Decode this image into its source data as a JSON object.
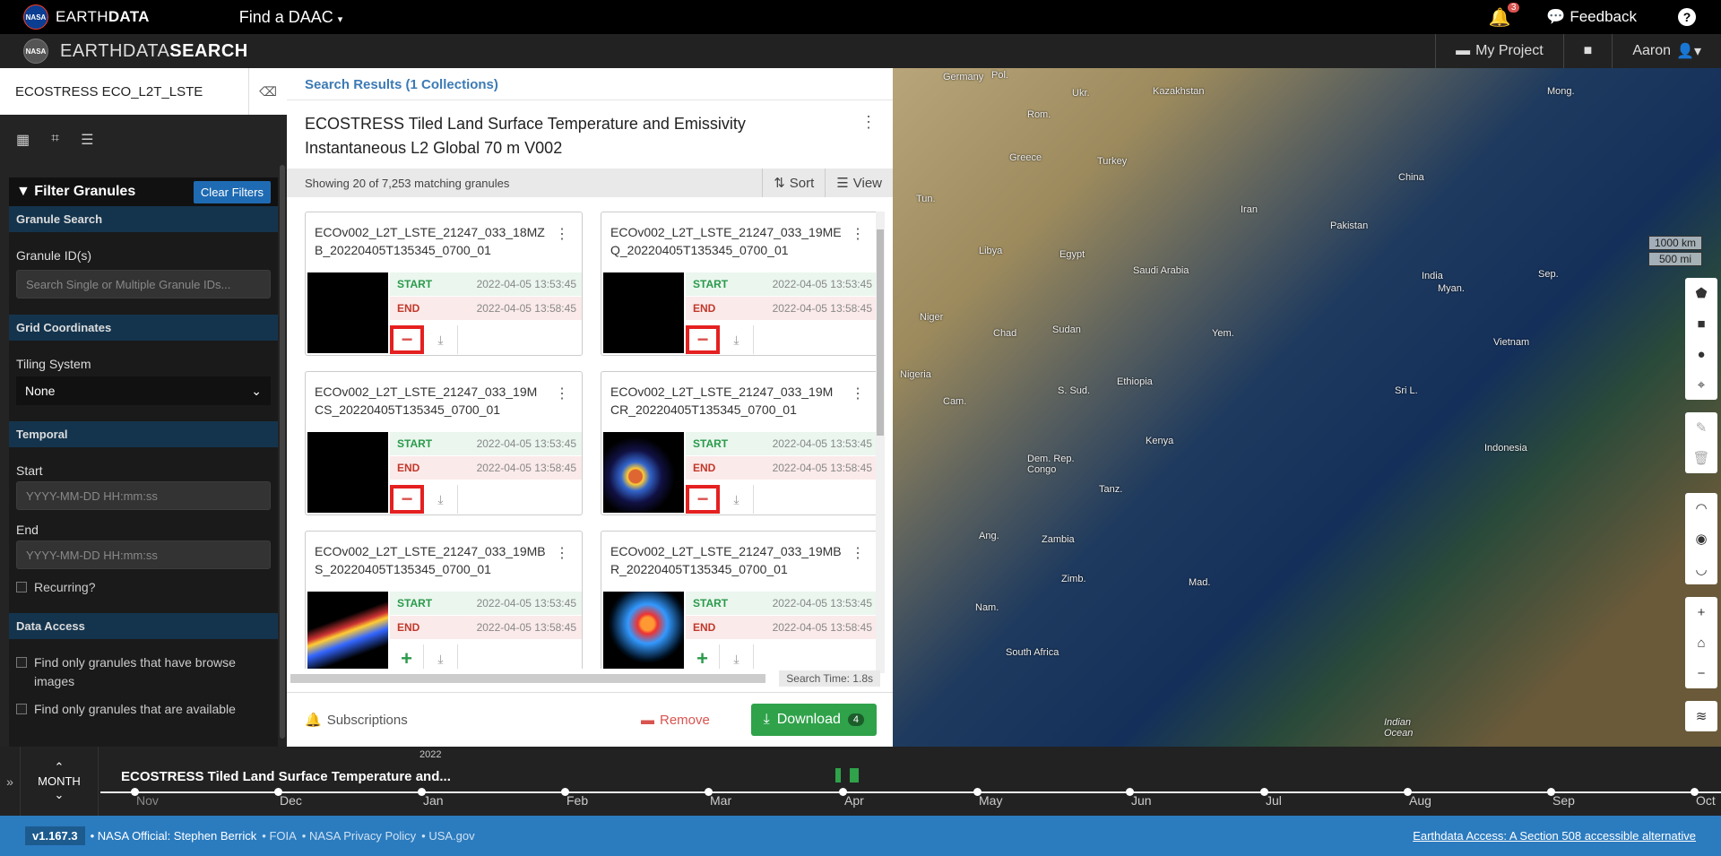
{
  "topbar": {
    "brand": "EARTH",
    "brand_bold": "DATA",
    "find_daac": "Find a DAAC",
    "notifications": "3",
    "feedback": "Feedback",
    "help": "?"
  },
  "appbar": {
    "brand": "EARTHDATA",
    "brand_bold": "SEARCH",
    "my_project": "My Project",
    "user": "Aaron"
  },
  "sidebar": {
    "search_value": "ECOSTRESS ECO_L2T_LSTE",
    "filter_title": "Filter Granules",
    "clear_filters": "Clear Filters",
    "granule_search": "Granule Search",
    "granule_ids_label": "Granule ID(s)",
    "granule_ids_placeholder": "Search Single or Multiple Granule IDs...",
    "grid_coords": "Grid Coordinates",
    "tiling_label": "Tiling System",
    "tiling_value": "None",
    "temporal": "Temporal",
    "start_label": "Start",
    "start_placeholder": "YYYY-MM-DD HH:mm:ss",
    "end_label": "End",
    "end_placeholder": "YYYY-MM-DD HH:mm:ss",
    "recurring": "Recurring?",
    "data_access": "Data Access",
    "browse_only": "Find only granules that have browse images",
    "available_only": "Find only granules that are available"
  },
  "results": {
    "header": "Search Results (1 Collections)",
    "collection_title": "ECOSTRESS Tiled Land Surface Temperature and Emissivity Instantaneous L2 Global 70 m V002",
    "showing": "Showing 20 of 7,253 matching granules",
    "sort": "Sort",
    "view": "View",
    "search_time": "Search Time:  1.8s",
    "subscriptions": "Subscriptions",
    "remove": "Remove",
    "download": "Download",
    "download_count": "4",
    "start_key": "START",
    "end_key": "END",
    "granules": [
      {
        "name": "ECOv002_L2T_LSTE_21247_033_18MZB_20220405T135345_0700_01",
        "start": "2022-04-05 13:53:45",
        "end": "2022-04-05 13:58:45",
        "added": true
      },
      {
        "name": "ECOv002_L2T_LSTE_21247_033_19MEQ_20220405T135345_0700_01",
        "start": "2022-04-05 13:53:45",
        "end": "2022-04-05 13:58:45",
        "added": true
      },
      {
        "name": "ECOv002_L2T_LSTE_21247_033_19MCS_20220405T135345_0700_01",
        "start": "2022-04-05 13:53:45",
        "end": "2022-04-05 13:58:45",
        "added": true
      },
      {
        "name": "ECOv002_L2T_LSTE_21247_033_19MCR_20220405T135345_0700_01",
        "start": "2022-04-05 13:53:45",
        "end": "2022-04-05 13:58:45",
        "added": true
      },
      {
        "name": "ECOv002_L2T_LSTE_21247_033_19MBS_20220405T135345_0700_01",
        "start": "2022-04-05 13:53:45",
        "end": "2022-04-05 13:58:45",
        "added": false
      },
      {
        "name": "ECOv002_L2T_LSTE_21247_033_19MBR_20220405T135345_0700_01",
        "start": "2022-04-05 13:53:45",
        "end": "2022-04-05 13:58:45",
        "added": false
      }
    ]
  },
  "map": {
    "scale_km": "1000 km",
    "scale_mi": "500 mi",
    "labels": [
      "Germany",
      "Pol.",
      "Ukr.",
      "Kazakhstan",
      "Mong.",
      "Rom.",
      "Greece",
      "Turkey",
      "Tun.",
      "Iran",
      "Pakistan",
      "China",
      "Libya",
      "Egypt",
      "Saudi Arabia",
      "India",
      "Myan.",
      "Niger",
      "Chad",
      "Sudan",
      "Yem.",
      "Vietnam",
      "Sep.",
      "Nigeria",
      "Ethiopia",
      "S. Sud.",
      "Cam.",
      "Sri L.",
      "Kenya",
      "Dem. Rep. Congo",
      "Indonesia",
      "Tanz.",
      "Ang.",
      "Zambia",
      "Zimb.",
      "Mad.",
      "Nam.",
      "South Africa",
      "Indian Ocean"
    ]
  },
  "timeline": {
    "zoom": "MONTH",
    "collection": "ECOSTRESS Tiled Land Surface Temperature and...",
    "year": "2022",
    "months": [
      "Nov",
      "Dec",
      "Jan",
      "Feb",
      "Mar",
      "Apr",
      "May",
      "Jun",
      "Jul",
      "Aug",
      "Sep",
      "Oct"
    ]
  },
  "footer": {
    "version": "v1.167.3",
    "official": "• NASA Official: Stephen Berrick",
    "foia": "• FOIA",
    "privacy": "• NASA Privacy Policy",
    "usa": "• USA.gov",
    "accessible": "Earthdata Access: A Section 508 accessible alternative"
  }
}
